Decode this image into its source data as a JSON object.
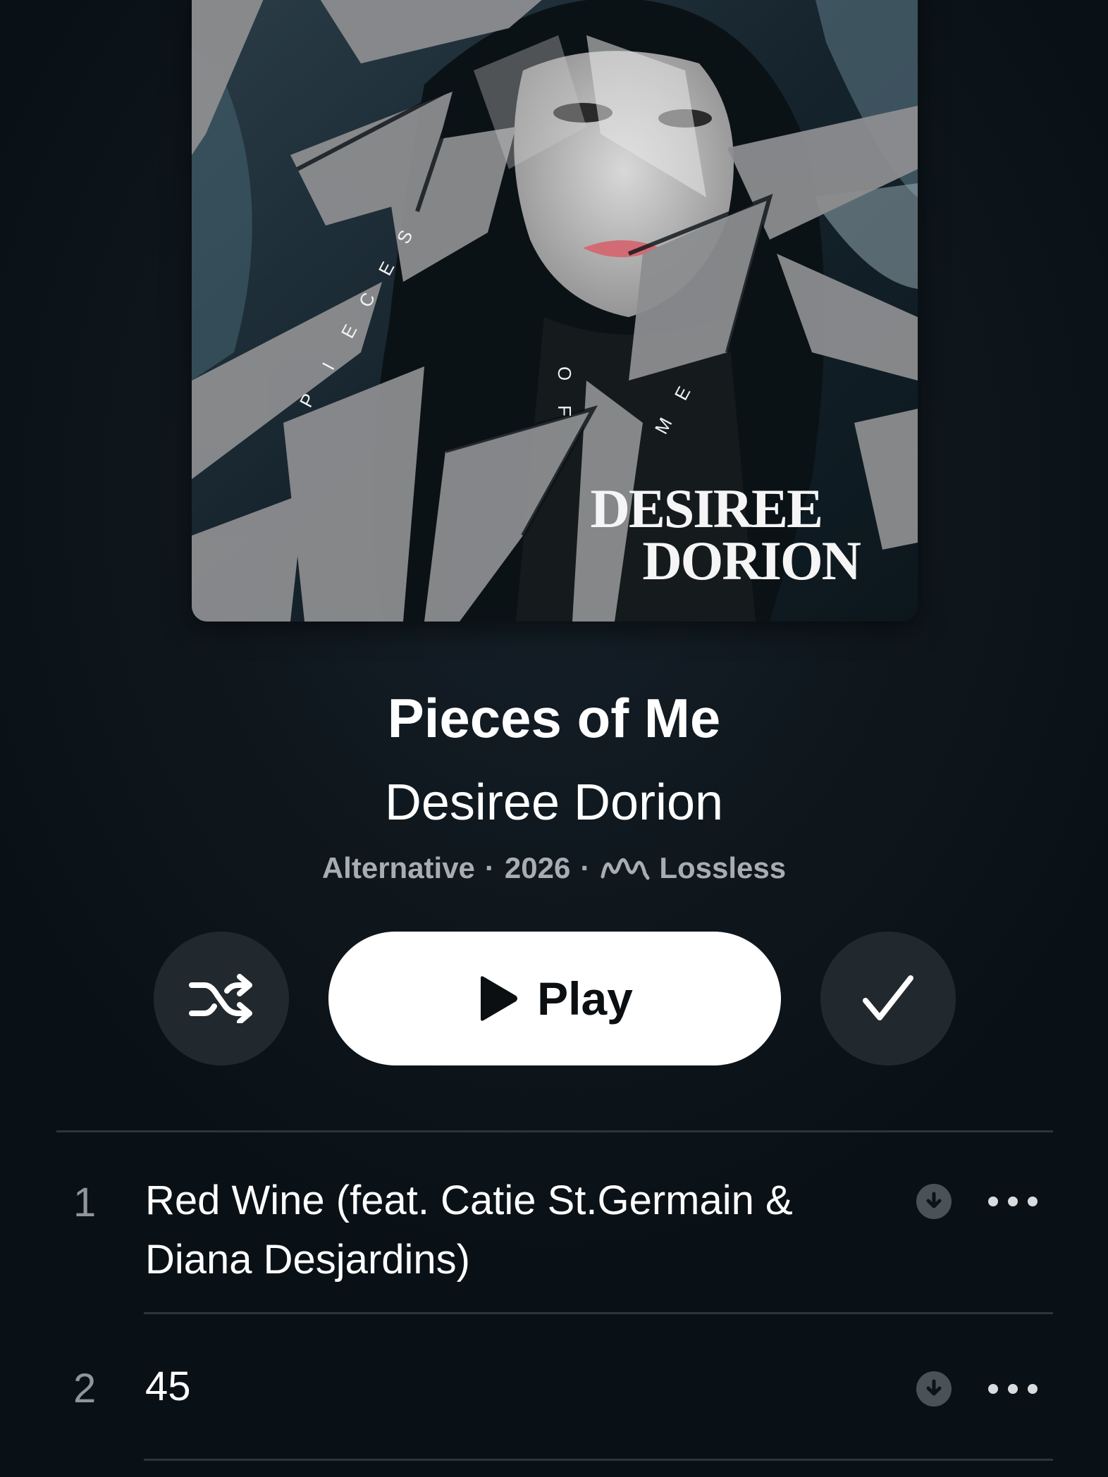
{
  "album": {
    "artwork": {
      "cover_word_1": [
        "P",
        "I",
        "E",
        "C",
        "E",
        "S"
      ],
      "cover_word_2": [
        "O",
        "F"
      ],
      "cover_word_3": [
        "M",
        "E"
      ],
      "cover_brand_line1": "DESIREE",
      "cover_brand_line2": "DORION"
    },
    "title": "Pieces of Me",
    "artist": "Desiree Dorion",
    "genre": "Alternative",
    "year": "2026",
    "separator": "·",
    "quality": "Lossless",
    "quality_icon": "lossless-waveform-icon"
  },
  "actions": {
    "shuffle_icon": "shuffle-icon",
    "play_label": "Play",
    "play_icon": "play-icon",
    "library_icon": "checkmark-icon"
  },
  "tracks": [
    {
      "number": "1",
      "title": "Red Wine (feat. Catie St.Germain & Diana Desjardins)",
      "download_icon": "download-icon",
      "more_icon": "more-icon"
    },
    {
      "number": "2",
      "title": "45",
      "download_icon": "download-icon",
      "more_icon": "more-icon"
    }
  ],
  "colors": {
    "background": "#0c1419",
    "button_dark": "#22292e",
    "play_button": "#ffffff",
    "meta_text": "#a7adb2",
    "track_number": "#8f969b",
    "divider": "#2d353b"
  }
}
